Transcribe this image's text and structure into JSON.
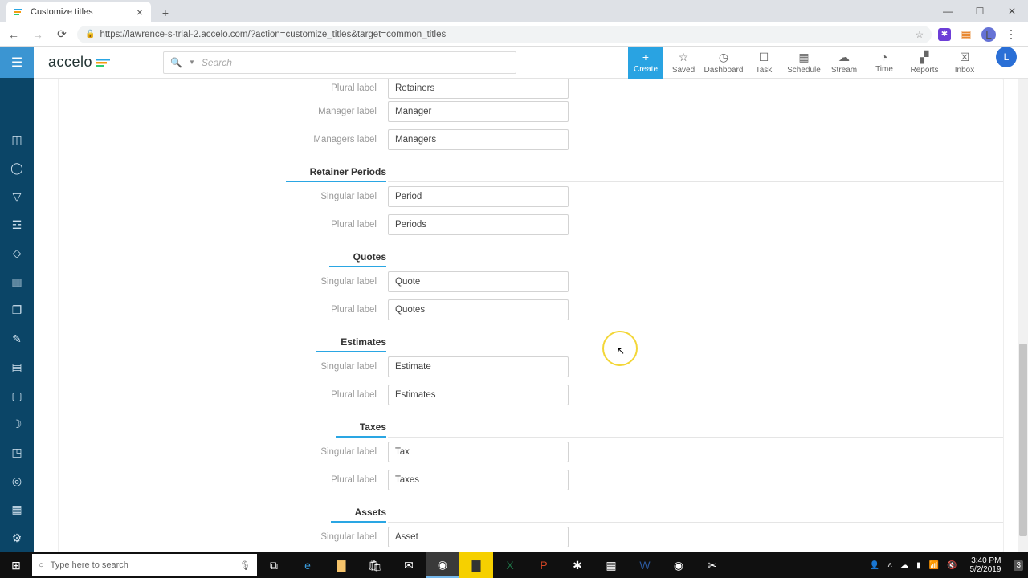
{
  "browser": {
    "tab_title": "Customize titles",
    "url": "https://lawrence-s-trial-2.accelo.com/?action=customize_titles&target=common_titles",
    "avatar_letter": "L"
  },
  "header": {
    "logo_text": "accelo",
    "search_placeholder": "Search",
    "tools": {
      "create": "Create",
      "saved": "Saved",
      "dashboard": "Dashboard",
      "task": "Task",
      "schedule": "Schedule",
      "stream": "Stream",
      "time": "Time",
      "reports": "Reports",
      "inbox": "Inbox"
    },
    "avatar_letter": "L"
  },
  "labels": {
    "singular": "Singular label",
    "plural": "Plural label",
    "manager": "Manager label",
    "managers": "Managers label"
  },
  "sections": {
    "retainers_top": {
      "plural_value": "Retainers",
      "manager_value": "Manager",
      "managers_value": "Managers"
    },
    "retainer_periods": {
      "title": "Retainer Periods",
      "singular_value": "Period",
      "plural_value": "Periods"
    },
    "quotes": {
      "title": "Quotes",
      "singular_value": "Quote",
      "plural_value": "Quotes"
    },
    "estimates": {
      "title": "Estimates",
      "singular_value": "Estimate",
      "plural_value": "Estimates"
    },
    "taxes": {
      "title": "Taxes",
      "singular_value": "Tax",
      "plural_value": "Taxes"
    },
    "assets": {
      "title": "Assets",
      "singular_value": "Asset"
    }
  },
  "taskbar": {
    "search_placeholder": "Type here to search",
    "time": "3:40 PM",
    "date": "5/2/2019",
    "notification_count": "3"
  }
}
